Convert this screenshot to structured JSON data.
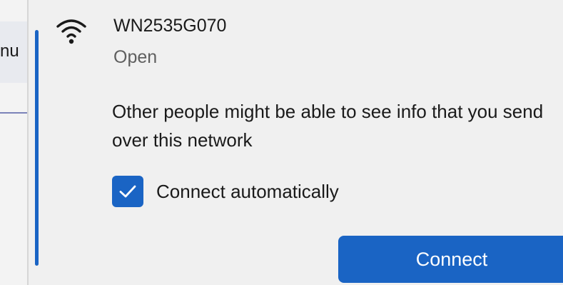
{
  "background_window": {
    "partial_text": "nu"
  },
  "network": {
    "icon": "wifi-icon",
    "name": "WN2535G070",
    "status": "Open",
    "warning": "Other people might be able to see info that you send over this network"
  },
  "connect_automatically": {
    "label": "Connect automatically",
    "checked": true
  },
  "connect_button": {
    "label": "Connect"
  },
  "colors": {
    "accent": "#1a64c4",
    "flyout_background": "#f0f0f0",
    "primary_text": "#1a1a1a",
    "secondary_text": "#5f5f5f"
  }
}
